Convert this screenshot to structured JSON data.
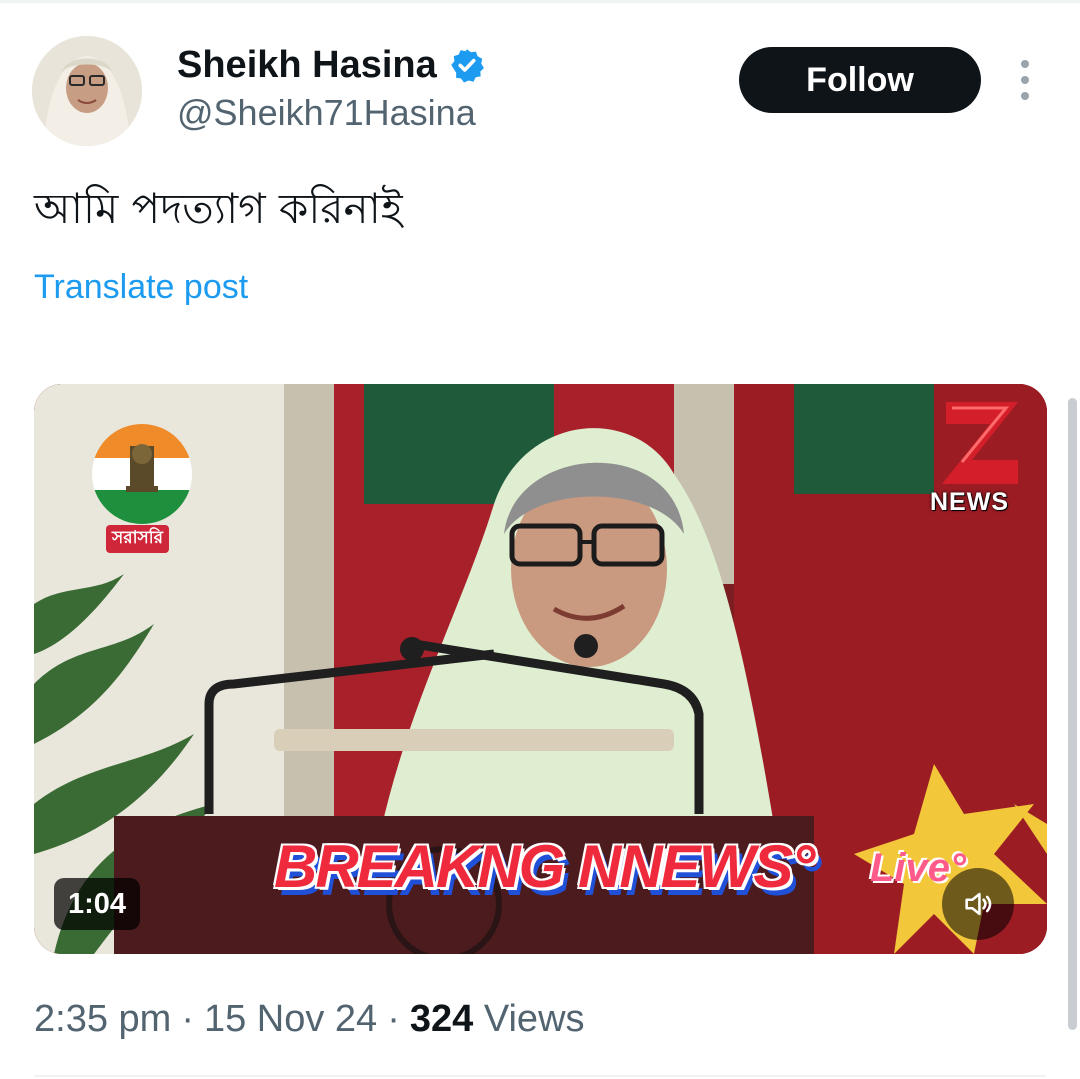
{
  "author": {
    "name": "Sheikh Hasina",
    "handle": "@Sheikh71Hasina",
    "verified_icon": "verified-badge-icon",
    "avatar_icon": "profile-photo"
  },
  "header": {
    "follow_label": "Follow",
    "more_icon": "more-vertical-icon"
  },
  "tweet": {
    "text": "আমি পদত্যাগ করিনাই",
    "translate_label": "Translate post"
  },
  "media": {
    "duration": "1:04",
    "channel_tag": "সরাসরি",
    "zee_news_label": "NEWS",
    "banner_text": "BREAKNG NNEWS°",
    "live_text": "Live°",
    "mute_icon": "speaker-muted-icon"
  },
  "meta": {
    "time": "2:35 pm",
    "separator": "·",
    "date": "15 Nov 24",
    "views_count": "324",
    "views_label": "Views"
  },
  "colors": {
    "accent": "#1d9bf0",
    "text_primary": "#0f1419",
    "text_secondary": "#536471",
    "button_dark": "#0f1419"
  }
}
